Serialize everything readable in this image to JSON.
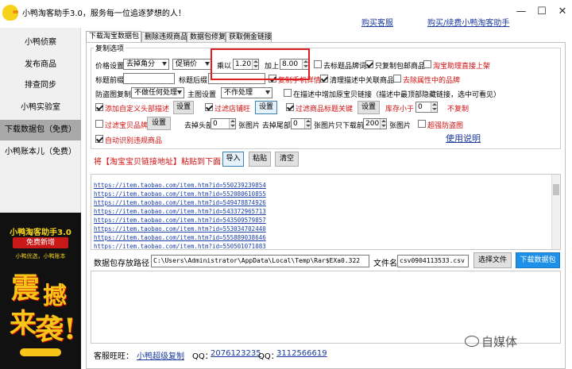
{
  "app": {
    "title": "小鸭淘客助手3.0，服务每一位追逐梦想的人！",
    "buy_link": "购买客服",
    "renew_link": "购买/续费小鸭淘客助手",
    "window_controls": {
      "minimize": "—",
      "maximize": "☐",
      "close": "✕"
    }
  },
  "sidebar": {
    "items": [
      {
        "label": "小鸭侦察"
      },
      {
        "label": "发布商品"
      },
      {
        "label": "排查同步"
      },
      {
        "label": "小鸭实验室"
      },
      {
        "label": "下载数据包（免费）"
      },
      {
        "label": "小鸭账本儿（免费）"
      }
    ],
    "active_index": 4,
    "promo": {
      "title": "小鸭淘客助手3.0",
      "badge": "免费新增",
      "subtitle": "小鸭优选，小鸭账本",
      "big1": "震",
      "big2": "撼",
      "big3": "来",
      "big4": "袭!",
      "colors": {
        "bg": "#111111",
        "gold": "#f5c518",
        "red": "#c81818"
      }
    }
  },
  "tabs": [
    {
      "label": "下载淘宝数据包"
    },
    {
      "label": "删除违规商品"
    },
    {
      "label": "数据包修复"
    },
    {
      "label": "获取佣金链接"
    }
  ],
  "copy_options": {
    "group_title": "复制选项",
    "price_label": "价格设置",
    "price_mode": "去掉角分",
    "price_base": "促销价",
    "multiply_label": "乘以",
    "multiply_value": "1.20",
    "add_label": "加上",
    "add_value": "8.00",
    "remove_brand": "去标题品牌词",
    "only_free_shipping": "只复制包邮商品",
    "taobao_helper_upload": "淘宝助理直接上架",
    "title_prefix_label": "标题前缀",
    "title_suffix_label": "标题后缀",
    "copy_mobile_detail": "复制手机详情",
    "clear_related_desc": "清理描述中关联商品",
    "remove_attr_brand": "去除属性中的品牌",
    "anti_hijack_label": "防盗图复制",
    "anti_hijack_value": "不做任何处理",
    "main_image_label": "主图设置",
    "main_image_value": "不作处理",
    "hidden_link_desc": "在描述中增加原宝贝链接（描述中最顶部隐藏链接，选中可看见）",
    "add_custom_header": "添加自定义头部描述",
    "filter_shop": "过滤店铺旺",
    "filter_title_keyword": "过滤商品标题关键",
    "stock_less_label": "库存小于",
    "stock_less_value": "0",
    "no_copy": "不复制",
    "filter_brand": "过滤宝贝品牌",
    "remove_head_label": "去掉头部",
    "remove_head_value": "0",
    "remove_tail_label": "张图片 去掉尾部",
    "remove_tail_value": "0",
    "keep_first_label": "张图片只下载前",
    "keep_first_value": "200",
    "images_label": "张图片",
    "super_anti_hijack": "超强防盗图",
    "auto_detect_violation": "自动识别违规商品",
    "usage_link": "使用说明",
    "settings_button": "设置"
  },
  "paste_bar": {
    "hint": "将【淘宝宝贝链接地址】粘贴到下面：",
    "import_button": "导入",
    "paste_button": "粘贴",
    "clear_button": "清空"
  },
  "urls": [
    "https://item.taobao.com/item.htm?id=550239239854",
    "https://item.taobao.com/item.htm?id=552080610855",
    "https://item.taobao.com/item.htm?id=549478874926",
    "https://item.taobao.com/item.htm?id=543372965713",
    "https://item.taobao.com/item.htm?id=543509579857",
    "https://item.taobao.com/item.htm?id=553034702440",
    "https://item.taobao.com/item.htm?id=555889038646",
    "https://item.taobao.com/item.htm?id=550501071083"
  ],
  "save_bar": {
    "path_label": "数据包存放路径",
    "path_value": "C:\\Users\\Administrator\\AppData\\Local\\Temp\\Rar$EXa0.322",
    "filename_label": "文件名",
    "filename_value": "csv0904113533.csv",
    "choose_file_button": "选择文件",
    "download_button": "下载数据包"
  },
  "footer": {
    "service_label": "客服旺旺：",
    "service_link": "小鸭超级复制",
    "qq1_label": "QQ：",
    "qq1": "2076123235",
    "qq2_label": "QQ：",
    "qq2": "3112566619"
  },
  "watermark": {
    "text": "自媒体"
  }
}
